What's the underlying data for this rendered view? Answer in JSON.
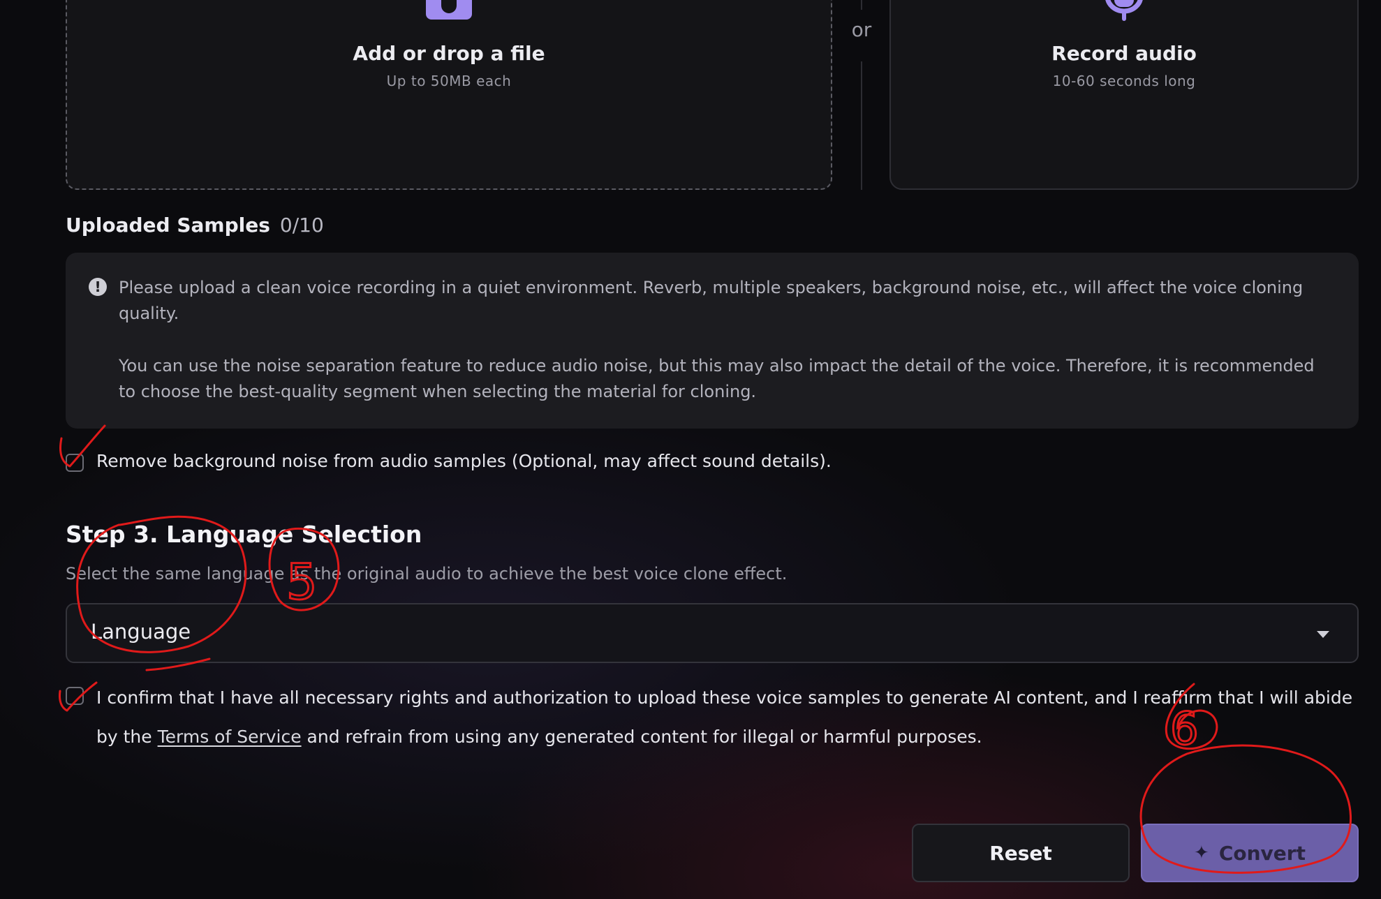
{
  "upload": {
    "title": "Add or drop a file",
    "subtitle": "Up to 50MB each"
  },
  "divider": {
    "or": "or"
  },
  "record": {
    "title": "Record audio",
    "subtitle": "10-60 seconds long"
  },
  "samples": {
    "label": "Uploaded Samples",
    "count": "0/10"
  },
  "info": {
    "paragraph1": "Please upload a clean voice recording in a quiet environment. Reverb, multiple speakers, background noise, etc., will affect the voice cloning quality.",
    "paragraph2": "You can use the noise separation feature to reduce audio noise, but this may also impact the detail of the voice. Therefore, it is recommended to choose the best-quality segment when selecting the material for cloning."
  },
  "noise_option": {
    "label": "Remove background noise from audio samples (Optional, may affect sound details).",
    "checked": false
  },
  "step3": {
    "title": "Step 3. Language Selection",
    "description": "Select the same language as the original audio to achieve the best voice clone effect."
  },
  "language_select": {
    "value": "Language"
  },
  "confirm": {
    "before": "I confirm that I have all necessary rights and authorization to upload these voice samples to generate AI content, and I reaffirm that I will abide by the ",
    "link": "Terms of Service",
    "after": " and refrain from using any generated content for illegal or harmful purposes.",
    "checked": false
  },
  "buttons": {
    "reset": "Reset",
    "convert": "Convert"
  },
  "annotations": {
    "mark_5": "5",
    "mark_6": "6"
  },
  "colors": {
    "accent": "#a08cf0",
    "convert_button": "#6b5fa8",
    "annotation": "#e01a1a"
  },
  "icons": {
    "upload": "upload-box-icon",
    "record": "microphone-icon",
    "info": "info-icon",
    "caret": "chevron-down-icon",
    "convert": "sparkle-icon"
  }
}
